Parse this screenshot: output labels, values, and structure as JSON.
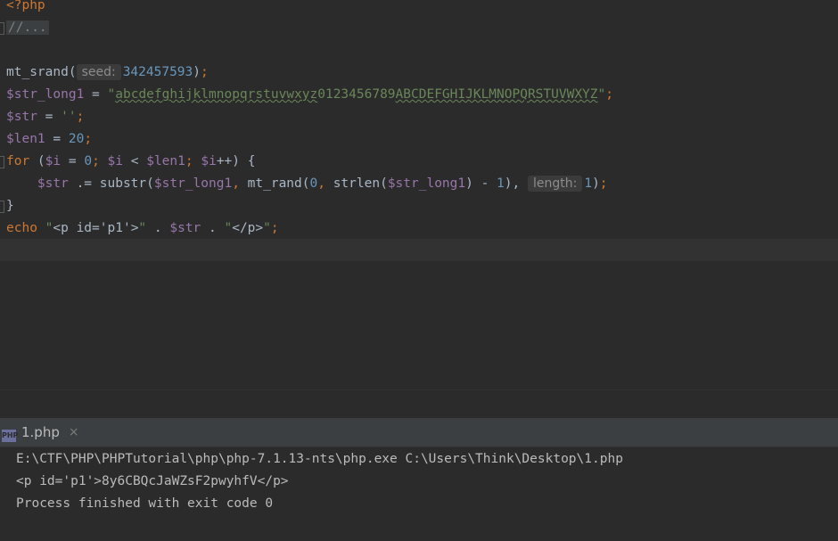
{
  "editor": {
    "lines": {
      "l0": {
        "tag": "<?php"
      },
      "l1": {
        "folded": "//..."
      },
      "l3": {
        "fn": "mt_srand(",
        "hint": "seed:",
        "num": "342457593",
        "close": ")",
        "semi": ";"
      },
      "l4": {
        "var": "$str_long1",
        "eq": " = ",
        "q1": "\"",
        "str_lower": "abcdefghijklmnopqrstuvwxyz",
        "str_digits": "0123456789",
        "str_upper": "ABCDEFGHIJKLMNOPQRSTUVWXYZ",
        "q2": "\"",
        "semi": ";"
      },
      "l5": {
        "var": "$str",
        "eq": " = ",
        "str": "''",
        "semi": ";"
      },
      "l6": {
        "var": "$len1",
        "eq": " = ",
        "num": "20",
        "semi": ";"
      },
      "l7": {
        "kw": "for",
        "p1": " (",
        "v1": "$i",
        "eq1": " = ",
        "n1": "0",
        "s1": "; ",
        "v2": "$i",
        "lt": " < ",
        "v3": "$len1",
        "s2": "; ",
        "v4": "$i",
        "inc": "++) {"
      },
      "l8": {
        "indent": "    ",
        "v1": "$str",
        "op": " .= substr(",
        "v2": "$str_long1",
        "c1": ", ",
        "fn": "mt_rand(",
        "n0": "0",
        "c2": ", ",
        "fn2": "strlen(",
        "v3": "$str_long1",
        "minus": ") - ",
        "n1": "1",
        "c3": "), ",
        "hint": "length:",
        "n2": "1",
        "close": ")",
        "semi": ";"
      },
      "l9": {
        "brace": "}"
      },
      "l10": {
        "kw": "echo",
        "sp": " ",
        "q1": "\"",
        "s1": "<p id='p1'>",
        "q2": "\"",
        "dot1": " . ",
        "var": "$str",
        "dot2": " . ",
        "q3": "\"",
        "s2": "</p>",
        "q4": "\"",
        "semi": ";"
      }
    }
  },
  "run": {
    "tab_icon": "PHP",
    "tab_label": "1.php",
    "tab_close": "×",
    "output": [
      "E:\\CTF\\PHP\\PHPTutorial\\php\\php-7.1.13-nts\\php.exe C:\\Users\\Think\\Desktop\\1.php",
      "<p id='p1'>8y6CBQcJaWZsF2pwyhfV</p>",
      "Process finished with exit code 0"
    ]
  },
  "colors": {
    "background": "#2b2b2b",
    "keyword": "#cc7832",
    "variable": "#9876aa",
    "number": "#6897bb",
    "string": "#6a8759",
    "text": "#a9b7c6"
  }
}
